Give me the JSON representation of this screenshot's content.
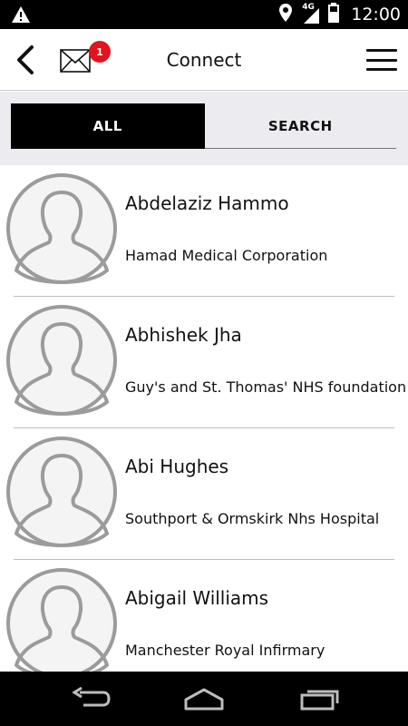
{
  "status_bar": {
    "time": "12:00",
    "network": "4G",
    "icons": [
      "warning-icon",
      "location-icon",
      "signal-icon",
      "battery-icon"
    ]
  },
  "app_bar": {
    "title": "Connect",
    "mail_badge_count": "1",
    "icons": [
      "back-arrow-icon",
      "envelope-icon",
      "hamburger-menu-icon"
    ]
  },
  "tabs": [
    {
      "label": "ALL",
      "active": true
    },
    {
      "label": "SEARCH",
      "active": false
    }
  ],
  "contacts": [
    {
      "name": "Abdelaziz Hammo",
      "organization": "Hamad Medical Corporation"
    },
    {
      "name": "Abhishek Jha",
      "organization": "Guy's and St. Thomas' NHS foundation"
    },
    {
      "name": "Abi Hughes",
      "organization": "Southport & Ormskirk Nhs Hospital"
    },
    {
      "name": "Abigail Williams",
      "organization": "Manchester Royal Infirmary"
    }
  ],
  "nav_bar": {
    "icons": [
      "back-nav-icon",
      "home-nav-icon",
      "recents-nav-icon"
    ]
  },
  "colors": {
    "badge": "#e3141b",
    "tab_active_bg": "#000000",
    "tabs_background": "#ebebf0",
    "avatar_gray": "#9b9b9b"
  }
}
